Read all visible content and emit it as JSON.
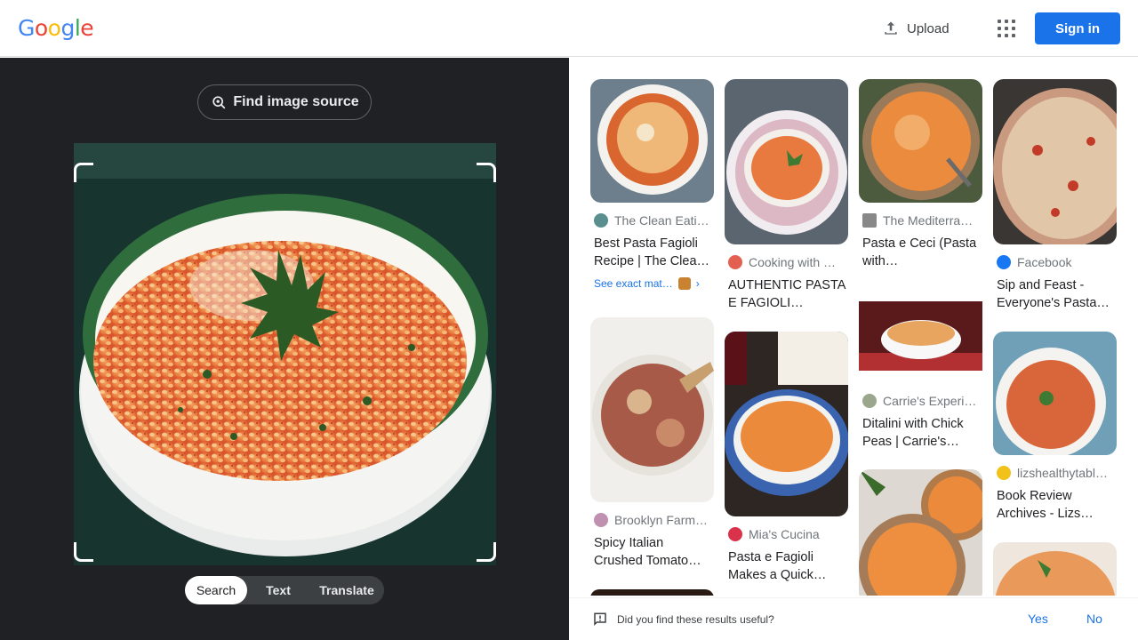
{
  "header": {
    "logo_letters": [
      "G",
      "o",
      "o",
      "g",
      "l",
      "e"
    ],
    "logo_colors": [
      "#4285f4",
      "#ea4335",
      "#fbbc05",
      "#4285f4",
      "#34a853",
      "#ea4335"
    ],
    "upload_label": "Upload",
    "signin_label": "Sign in"
  },
  "left_panel": {
    "find_source_label": "Find image source",
    "tabs": [
      "Search",
      "Text",
      "Translate"
    ],
    "active_tab": "Search"
  },
  "results": [
    {
      "source": "The Clean Eati…",
      "title": "Best Pasta Fagioli Recipe | The Clea…",
      "exact_match": "See exact mat…"
    },
    {
      "source": "Cooking with …",
      "title": "AUTHENTIC PASTA E FAGIOLI…"
    },
    {
      "source": "The Mediterra…",
      "title": "Pasta e Ceci (Pasta with…"
    },
    {
      "source": "Facebook",
      "title": "Sip and Feast - Everyone's Pasta…"
    },
    {
      "source": "Brooklyn Farm…",
      "title": "Spicy Italian Crushed Tomato…"
    },
    {
      "source": "Mia's Cucina",
      "title": "Pasta e Fagioli Makes a Quick…"
    },
    {
      "source": "Carrie's Experi…",
      "title": "Ditalini with Chick Peas | Carrie's…"
    },
    {
      "source": "lizshealthytabl…",
      "title": "Book Review Archives - Lizs…"
    }
  ],
  "footer": {
    "question": "Did you find these results useful?",
    "yes_label": "Yes",
    "no_label": "No"
  },
  "colors": {
    "accent": "#1a73e8",
    "dark_panel": "#202124"
  }
}
